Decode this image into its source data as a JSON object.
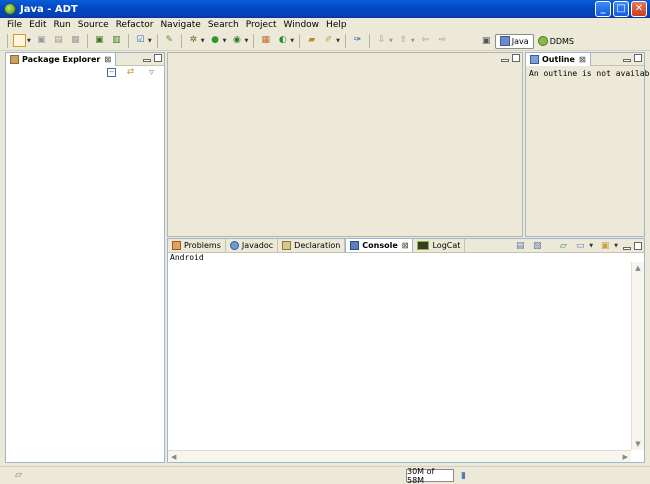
{
  "window": {
    "title": "Java - ADT"
  },
  "menu": [
    "File",
    "Edit",
    "Run",
    "Source",
    "Refactor",
    "Navigate",
    "Search",
    "Project",
    "Window",
    "Help"
  ],
  "perspectives": [
    {
      "label": "Java",
      "active": true
    },
    {
      "label": "DDMS",
      "active": false
    }
  ],
  "package_explorer": {
    "tab_label": "Package Explorer"
  },
  "outline": {
    "tab_label": "Outline",
    "message": "An outline is not available."
  },
  "console_panel": {
    "tabs": [
      {
        "label": "Problems",
        "active": false
      },
      {
        "label": "Javadoc",
        "active": false
      },
      {
        "label": "Declaration",
        "active": false
      },
      {
        "label": "Console",
        "active": true
      },
      {
        "label": "LogCat",
        "active": false
      }
    ],
    "console_name": "Android"
  },
  "status": {
    "heap": "30M of 58M"
  },
  "colors": {
    "title_bar": "#0a5fd8",
    "panel_border": "#9eb6ce",
    "chrome": "#ece9d8"
  }
}
